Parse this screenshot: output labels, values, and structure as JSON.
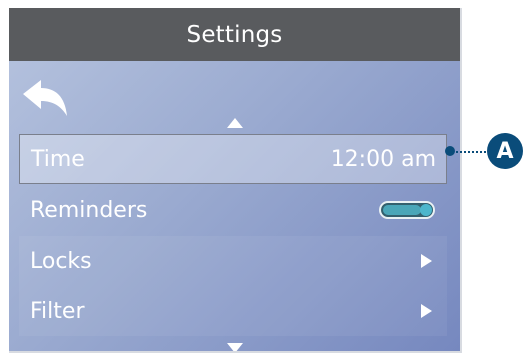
{
  "header": {
    "title": "Settings"
  },
  "nav": {
    "back_icon": "back-arrow-icon",
    "scroll_up_icon": "triangle-up-icon",
    "scroll_down_icon": "triangle-down-icon"
  },
  "menu": {
    "items": [
      {
        "label": "Time",
        "value": "12:00 am",
        "selected": true
      },
      {
        "label": "Reminders",
        "control": "toggle",
        "state": "on"
      },
      {
        "label": "Locks",
        "icon": "chevron-right-icon"
      },
      {
        "label": "Filter",
        "icon": "chevron-right-icon"
      }
    ]
  },
  "callout": {
    "label": "A",
    "color": "#0a4c7a"
  },
  "colors": {
    "title_bar": "#595b5e",
    "toggle_track": "#33606e",
    "toggle_fill": "#4aa6b8"
  }
}
